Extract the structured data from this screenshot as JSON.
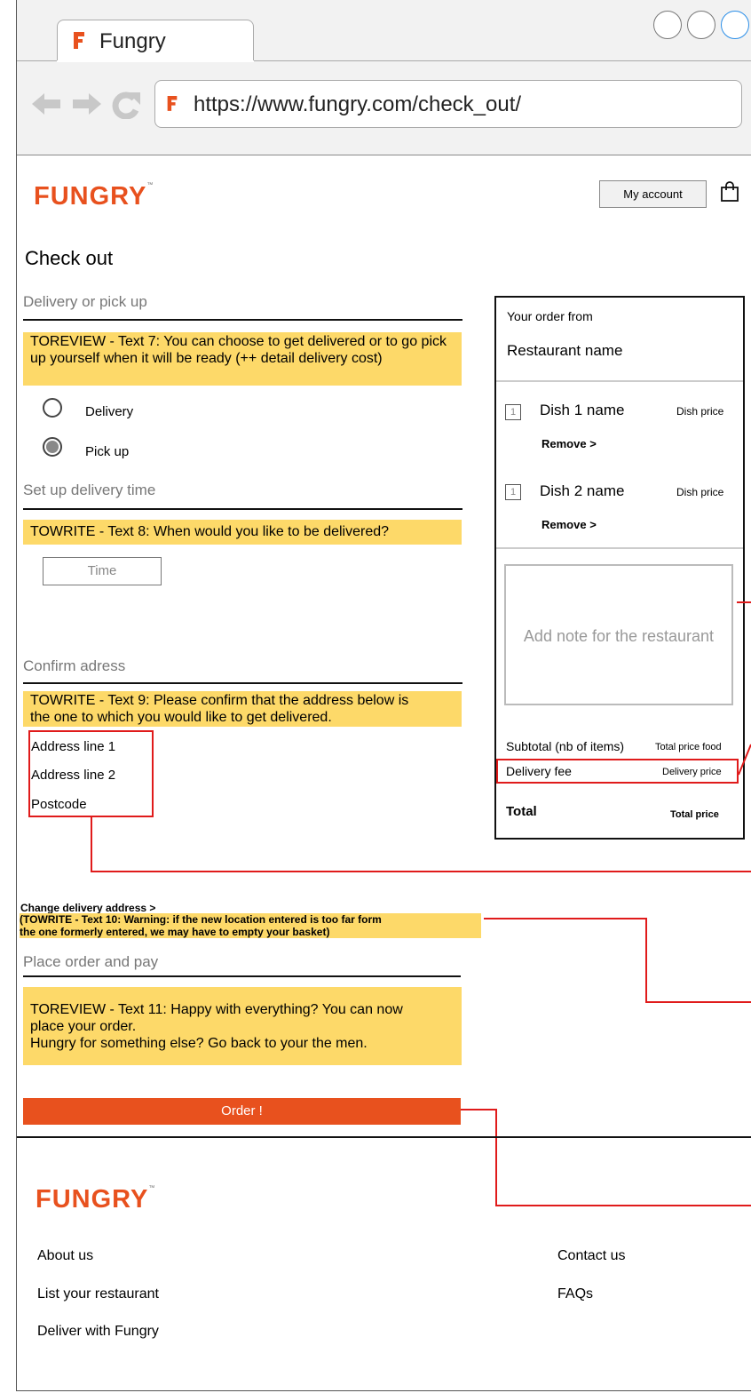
{
  "browser": {
    "tab_title": "Fungry",
    "url": "https://www.fungry.com/check_out/"
  },
  "header": {
    "logo": "FUNGRY",
    "trademark": "™",
    "account_button": "My account"
  },
  "page_title": "Check out",
  "delivery": {
    "section_label": "Delivery or pick up",
    "note": "TOREVIEW - Text 7: You can choose to get delivered or to go pick up yourself when it will be ready (++ detail delivery cost)",
    "options": [
      {
        "label": "Delivery",
        "selected": false
      },
      {
        "label": "Pick up",
        "selected": true
      }
    ]
  },
  "time": {
    "section_label": "Set up delivery time",
    "note": "TOWRITE - Text 8: When would you like to be delivered?",
    "input_placeholder": "Time"
  },
  "address": {
    "section_label": "Confirm adress",
    "note_line1": "TOWRITE - Text 9: Please confirm that the address below is",
    "note_line2": "the one to which you would like to get delivered.",
    "line1": "Address line 1",
    "line2": "Address line 2",
    "postcode": "Postcode",
    "change_link": "Change delivery address >",
    "warning_line1": "(TOWRITE - Text 10: Warning: if the new location entered is too far form",
    "warning_line2": "the one formerly entered, we may have to empty your basket)"
  },
  "pay": {
    "section_label": "Place order and pay",
    "note_line1": "TOREVIEW - Text 11: Happy with everything? You can now",
    "note_line2": "place your order.",
    "note_line3": "Hungry for something else? Go back to your the men.",
    "order_button": "Order !"
  },
  "order_summary": {
    "heading": "Your order from",
    "restaurant": "Restaurant name",
    "items": [
      {
        "qty": "1",
        "name": "Dish 1 name",
        "price": "Dish price",
        "remove": "Remove  >"
      },
      {
        "qty": "1",
        "name": "Dish 2 name",
        "price": "Dish price",
        "remove": "Remove  >"
      }
    ],
    "note_placeholder": "Add note for the restaurant",
    "subtotal_label": "Subtotal (nb of items)",
    "subtotal_value": "Total price food",
    "delivery_label": "Delivery fee",
    "delivery_value": "Delivery price",
    "total_label": "Total",
    "total_value": "Total price"
  },
  "footer": {
    "logo": "FUNGRY",
    "trademark": "™",
    "links_left": [
      "About us",
      "List your restaurant",
      "Deliver with Fungry"
    ],
    "links_right": [
      "Contact us",
      "FAQs"
    ]
  },
  "colors": {
    "brand": "#e8511e",
    "highlight": "#fdd969",
    "annotation": "#e01b1b"
  }
}
